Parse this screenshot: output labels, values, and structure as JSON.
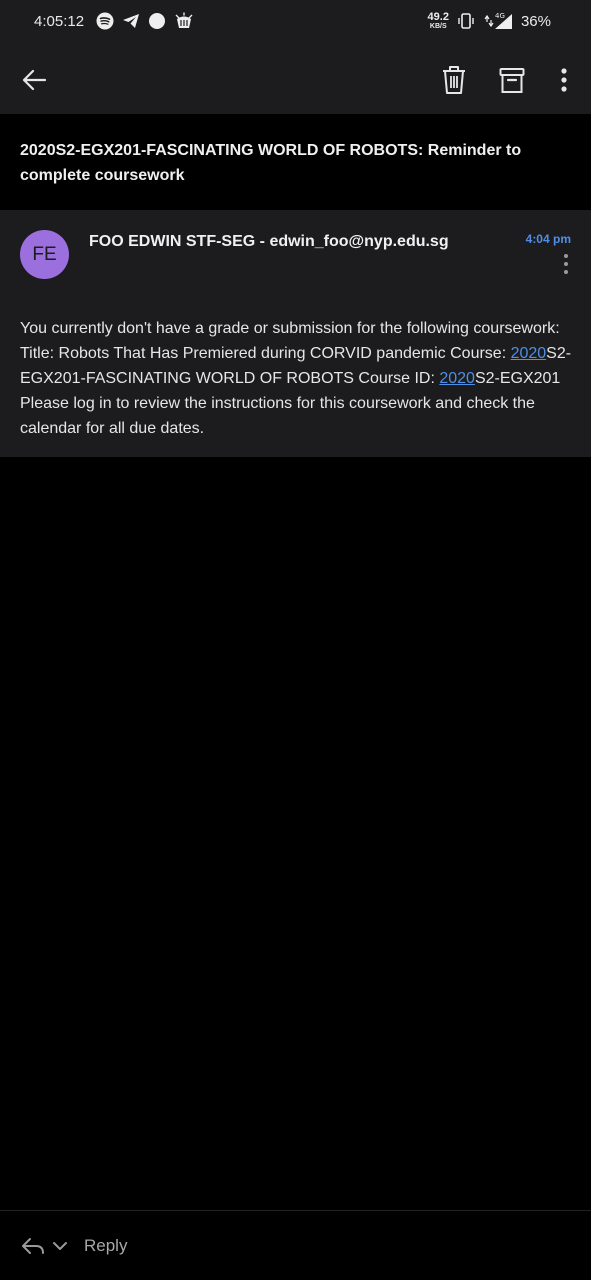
{
  "status_bar": {
    "time": "4:05:12",
    "net_speed_value": "49.2",
    "net_speed_unit": "KB/S",
    "network_type": "4G",
    "battery": "36%"
  },
  "toolbar": {
    "back_icon": "arrow-back-icon",
    "delete_icon": "trash-icon",
    "archive_icon": "archive-icon",
    "more_icon": "more-vert-icon"
  },
  "email": {
    "subject": "2020S2-EGX201-FASCINATING WORLD OF ROBOTS: Reminder to complete coursework",
    "avatar_initials": "FE",
    "sender": "FOO EDWIN STF-SEG - edwin_foo@nyp.edu.sg",
    "time": "4:04 pm",
    "body_part1": "You currently don't have a grade or submission for the following coursework: Title: Robots That Has Premiered during CORVID pandemic Course: ",
    "body_link1": "2020",
    "body_part2": "S2-EGX201-FASCINATING WORLD OF ROBOTS Course ID: ",
    "body_link2": "2020",
    "body_part3": "S2-EGX201 Please log in to review the instructions for this coursework and check the calendar for all due dates."
  },
  "footer": {
    "reply_label": "Reply"
  },
  "colors": {
    "background": "#000000",
    "surface": "#1c1c1e",
    "accent": "#4f8fe6",
    "avatar": "#9c6fdf"
  }
}
